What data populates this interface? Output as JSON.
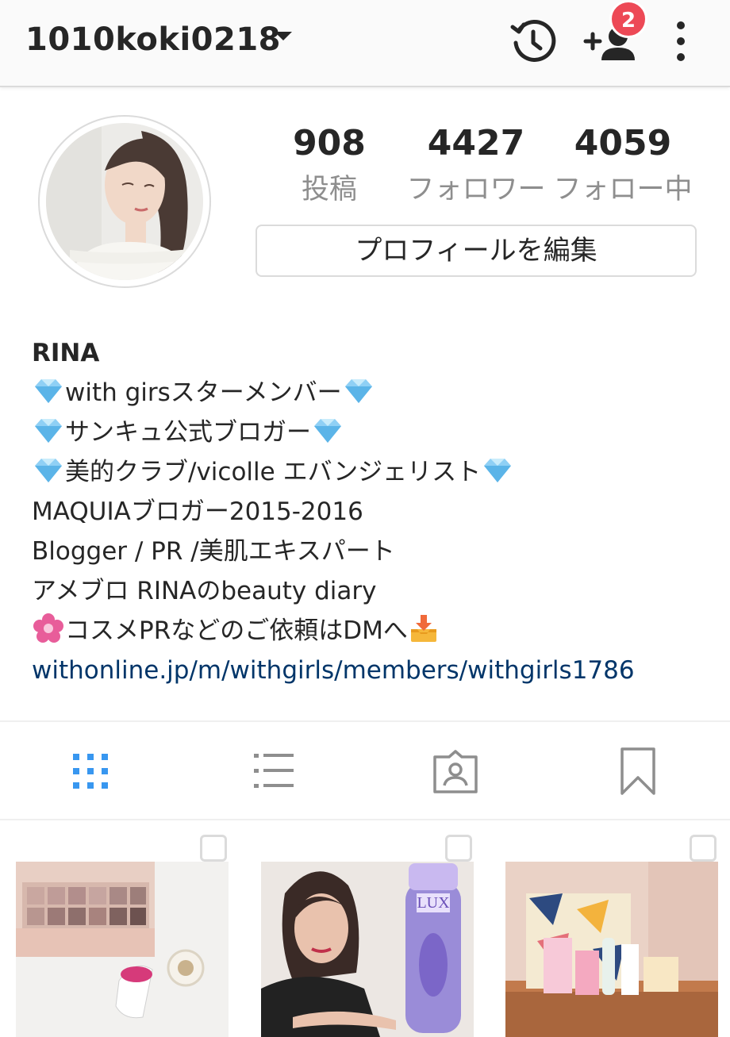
{
  "header": {
    "username": "1010koki0218",
    "notification_count": "2"
  },
  "profile": {
    "stats": [
      {
        "value": "908",
        "label": "投稿"
      },
      {
        "value": "4427",
        "label": "フォロワー"
      },
      {
        "value": "4059",
        "label": "フォロー中"
      }
    ],
    "edit_profile_label": "プロフィールを編集"
  },
  "bio": {
    "name": "RINA",
    "lines": [
      "with girsスターメンバー",
      "サンキュ公式ブロガー",
      "美的クラブ/vicolle エバンジェリスト",
      "MAQUIAブロガー2015-2016",
      "Blogger / PR /美肌エキスパート",
      "アメブロ RINAのbeauty diary",
      "コスメPRなどのご依頼はDMへ"
    ],
    "link": "withonline.jp/m/withgirls/members/withgirls1786"
  },
  "tabs": [
    {
      "icon": "grid-icon",
      "active": true
    },
    {
      "icon": "list-icon",
      "active": false
    },
    {
      "icon": "tagged-icon",
      "active": false
    },
    {
      "icon": "bookmark-icon",
      "active": false
    }
  ],
  "colors": {
    "accent": "#3897f0",
    "badge": "#ed4956",
    "link": "#003569",
    "muted": "#8e8e8e"
  }
}
